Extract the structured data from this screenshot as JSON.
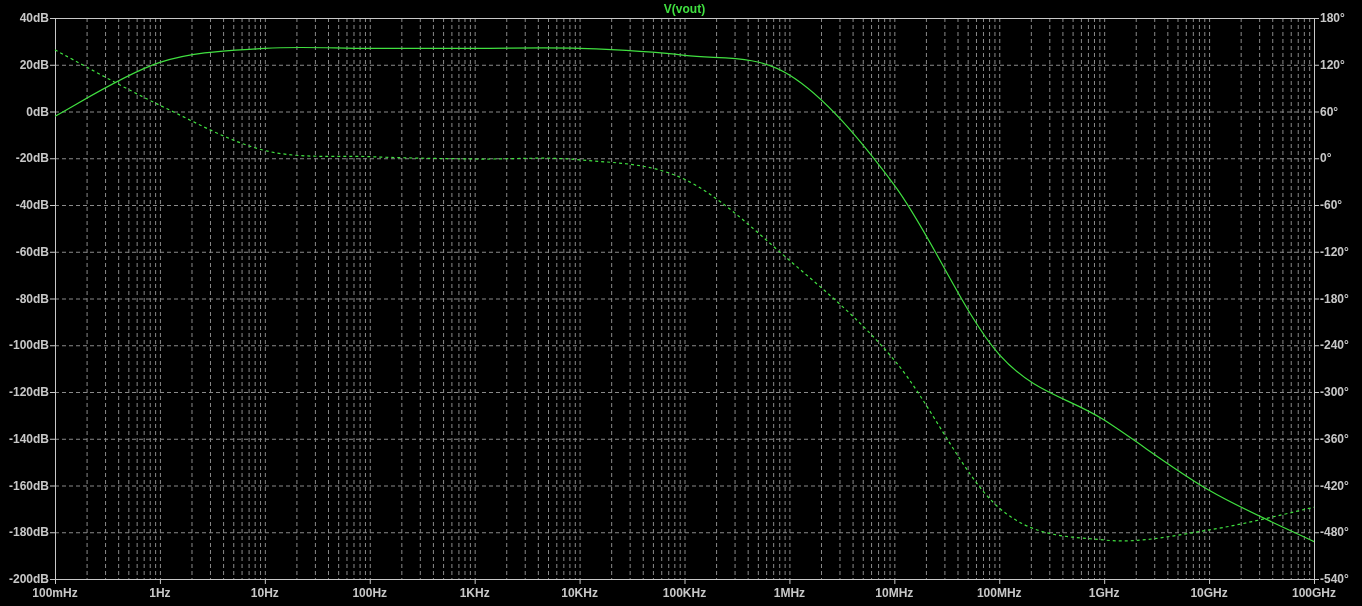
{
  "chart_data": {
    "type": "line",
    "title": "V(vout)",
    "grid": true,
    "categories": [
      "100mHz",
      "1Hz",
      "10Hz",
      "100Hz",
      "1KHz",
      "10KHz",
      "100KHz",
      "1MHz",
      "10MHz",
      "100MHz",
      "1GHz",
      "10GHz",
      "100GHz"
    ],
    "ylim": [
      -200,
      40
    ],
    "y2lim": [
      -540,
      180
    ],
    "yticks": [
      {
        "value": 40,
        "label": "40dB"
      },
      {
        "value": 20,
        "label": "20dB"
      },
      {
        "value": 0,
        "label": "0dB"
      },
      {
        "value": -20,
        "label": "-20dB"
      },
      {
        "value": -40,
        "label": "-40dB"
      },
      {
        "value": -60,
        "label": "-60dB"
      },
      {
        "value": -80,
        "label": "-80dB"
      },
      {
        "value": -100,
        "label": "-100dB"
      },
      {
        "value": -120,
        "label": "-120dB"
      },
      {
        "value": -140,
        "label": "-140dB"
      },
      {
        "value": -160,
        "label": "-160dB"
      },
      {
        "value": -180,
        "label": "-180dB"
      },
      {
        "value": -200,
        "label": "-200dB"
      }
    ],
    "y2ticks": [
      {
        "value": 180,
        "label": "180°"
      },
      {
        "value": 120,
        "label": "120°"
      },
      {
        "value": 60,
        "label": "60°"
      },
      {
        "value": 0,
        "label": "0°"
      },
      {
        "value": -60,
        "label": "-60°"
      },
      {
        "value": -120,
        "label": "-120°"
      },
      {
        "value": -180,
        "label": "-180°"
      },
      {
        "value": -240,
        "label": "-240°"
      },
      {
        "value": -300,
        "label": "-300°"
      },
      {
        "value": -360,
        "label": "-360°"
      },
      {
        "value": -420,
        "label": "-420°"
      },
      {
        "value": -480,
        "label": "-480°"
      },
      {
        "value": -540,
        "label": "-540°"
      }
    ],
    "series": [
      {
        "color": "#40e040",
        "line_style": "solid",
        "values": [
          -2,
          21,
          27,
          27,
          27,
          27,
          24,
          15.6,
          -31.5,
          -104,
          -132,
          -162,
          -184
        ]
      },
      {
        "axis": "y2",
        "color": "#40e040",
        "line_style": "dashed",
        "values": [
          139,
          68,
          10,
          2,
          -1,
          -2,
          -27,
          -131,
          -259,
          -449,
          -490,
          -477,
          -448
        ]
      }
    ]
  }
}
